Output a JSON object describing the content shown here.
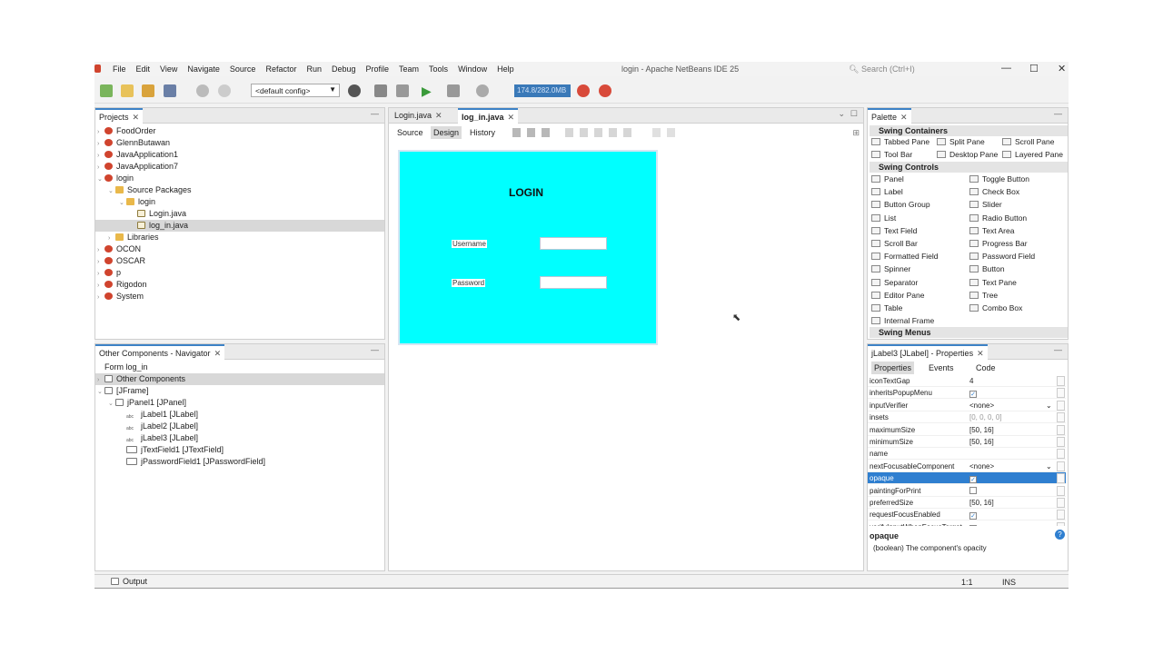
{
  "menu": [
    "File",
    "Edit",
    "View",
    "Navigate",
    "Source",
    "Refactor",
    "Run",
    "Debug",
    "Profile",
    "Team",
    "Tools",
    "Window",
    "Help"
  ],
  "window_title": "login - Apache NetBeans IDE 25",
  "search_placeholder": "Search (Ctrl+I)",
  "toolbar": {
    "config": "<default config>",
    "memory": "174.8/282.0MB"
  },
  "projects": {
    "tab": "Projects",
    "items": [
      "FoodOrder",
      "GlennButawan",
      "JavaApplication1",
      "JavaApplication7",
      "login",
      "Source Packages",
      "login",
      "Login.java",
      "log_in.java",
      "Libraries",
      "OCON",
      "OSCAR",
      "p",
      "Rigodon",
      "System"
    ]
  },
  "navigator": {
    "tab": "Other Components - Navigator",
    "items": [
      "Form log_in",
      "Other Components",
      "[JFrame]",
      "jPanel1 [JPanel]",
      "jLabel1 [JLabel]",
      "jLabel2 [JLabel]",
      "jLabel3 [JLabel]",
      "jTextField1 [JTextField]",
      "jPasswordField1 [JPasswordField]"
    ]
  },
  "editor": {
    "tabs": [
      "Login.java",
      "log_in.java"
    ],
    "subtabs": [
      "Source",
      "Design",
      "History"
    ],
    "form": {
      "title": "LOGIN",
      "username_label": "Username",
      "password_label": "Password",
      "bg": "#00ffff"
    }
  },
  "palette": {
    "tab": "Palette",
    "containers_header": "Swing Containers",
    "containers": [
      "Tabbed Pane",
      "Split Pane",
      "Scroll Pane",
      "Tool Bar",
      "Desktop Pane",
      "Layered Pane"
    ],
    "controls_header": "Swing Controls",
    "controls_left": [
      "Panel",
      "Label",
      "Button Group",
      "List",
      "Text Field",
      "Scroll Bar",
      "Formatted Field",
      "Spinner",
      "Separator",
      "Editor Pane",
      "Table",
      "Internal Frame"
    ],
    "controls_right": [
      "Toggle Button",
      "Check Box",
      "Slider",
      "Radio Button",
      "Text Area",
      "Progress Bar",
      "Password Field",
      "Button",
      "Text Pane",
      "Tree",
      "Combo Box"
    ],
    "menus_header": "Swing Menus"
  },
  "properties": {
    "tab": "jLabel3 [JLabel] - Properties",
    "subtabs": [
      "Properties",
      "Events",
      "Code"
    ],
    "rows": [
      {
        "name": "iconTextGap",
        "value": "4"
      },
      {
        "name": "inheritsPopupMenu",
        "value": "checked"
      },
      {
        "name": "inputVerifier",
        "value": "<none>"
      },
      {
        "name": "insets",
        "value": "[0, 0, 0, 0]"
      },
      {
        "name": "maximumSize",
        "value": "[50, 16]"
      },
      {
        "name": "minimumSize",
        "value": "[50, 16]"
      },
      {
        "name": "name",
        "value": ""
      },
      {
        "name": "nextFocusableComponent",
        "value": "<none>"
      },
      {
        "name": "opaque",
        "value": "checked"
      },
      {
        "name": "paintingForPrint",
        "value": "unchecked"
      },
      {
        "name": "preferredSize",
        "value": "[50, 16]"
      },
      {
        "name": "requestFocusEnabled",
        "value": "checked"
      },
      {
        "name": "verifyInputWhenFocusTarget",
        "value": "checked"
      }
    ],
    "help_title": "opaque",
    "help_text": "(boolean) The component's opacity"
  },
  "status": {
    "output": "Output",
    "position": "1:1",
    "mode": "INS"
  }
}
